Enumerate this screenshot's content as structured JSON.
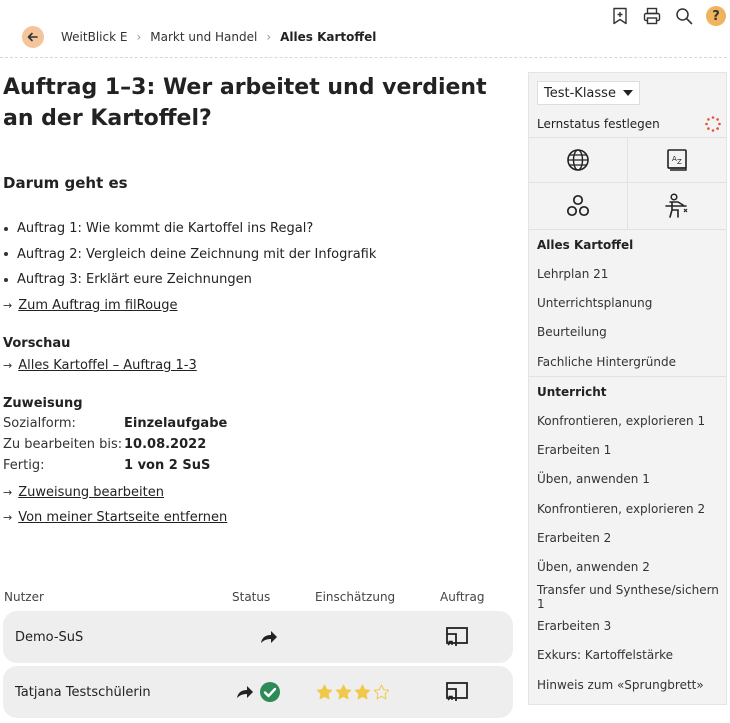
{
  "breadcrumb": {
    "items": [
      "WeitBlick E",
      "Markt und Handel"
    ],
    "current": "Alles Kartoffel"
  },
  "top_icons": [
    "bookmark-icon",
    "print-icon",
    "search-icon",
    "help-icon"
  ],
  "help_label": "?",
  "title": "Auftrag 1–3: Wer arbeitet und verdient an der Kartoffel?",
  "intro": {
    "heading": "Darum geht es",
    "bullets": [
      "Auftrag 1: Wie kommt die Kartoffel ins Regal?",
      "Auftrag 2: Vergleich deine Zeichnung mit der Infografik",
      "Auftrag 3: Erklärt eure Zeichnungen"
    ],
    "link": "Zum Auftrag im filRouge"
  },
  "preview": {
    "heading": "Vorschau",
    "link": "Alles Kartoffel – Auftrag 1-3"
  },
  "assignment": {
    "heading": "Zuweisung",
    "rows": [
      {
        "key": "Sozialform:",
        "value": "Einzelaufgabe"
      },
      {
        "key": "Zu bearbeiten bis:",
        "value": "10.08.2022"
      },
      {
        "key": "Fertig:",
        "value": "1 von 2 SuS"
      }
    ],
    "links": [
      "Zuweisung bearbeiten",
      "Von meiner Startseite entfernen"
    ]
  },
  "users_table": {
    "columns": [
      "Nutzer",
      "Status",
      "Einschätzung",
      "Auftrag"
    ],
    "rows": [
      {
        "name": "Demo-SuS",
        "status": [
          "submitted"
        ],
        "rating": null
      },
      {
        "name": "Tatjana Testschülerin",
        "status": [
          "submitted",
          "done"
        ],
        "rating": 3,
        "rating_max": 4
      }
    ]
  },
  "sidebar": {
    "class_select": "Test-Klasse",
    "status_label": "Lernstatus festlegen",
    "icon_buttons": [
      "globe-icon",
      "glossary-icon",
      "connections-icon",
      "teacher-icon"
    ],
    "sections": [
      {
        "heading": "Alles Kartoffel",
        "items": [
          "Lehrplan 21",
          "Unterrichtsplanung",
          "Beurteilung",
          "Fachliche Hintergründe"
        ]
      },
      {
        "heading": "Unterricht",
        "items": [
          "Konfrontieren, explorieren 1",
          "Erarbeiten 1",
          "Üben, anwenden 1",
          "Konfrontieren, explorieren 2",
          "Erarbeiten 2",
          "Üben, anwenden 2",
          "Transfer und Synthese/sichern 1",
          "Erarbeiten 3",
          "Exkurs: Kartoffelstärke",
          "Hinweis zum «Sprungbrett»"
        ]
      }
    ]
  },
  "colors": {
    "back_button": "#f4c49a",
    "help_badge": "#f0b45e",
    "done_check": "#2e8b57",
    "star": "#f1c94a",
    "row_bg": "#eeeeee",
    "sidebar_bg": "#f3f3f3",
    "spinner": "#e0553a"
  }
}
